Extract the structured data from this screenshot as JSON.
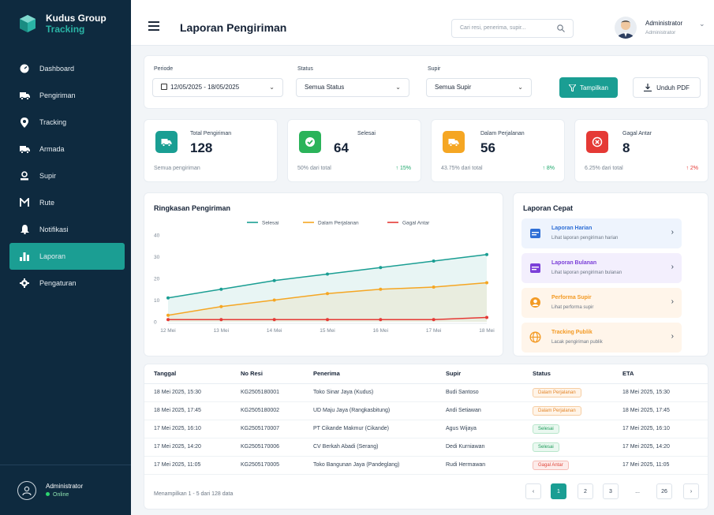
{
  "brand": {
    "name": "Kudus Group",
    "sub": "Tracking"
  },
  "sidebar": {
    "items": [
      {
        "label": "Dashboard",
        "icon": "dashboard-icon"
      },
      {
        "label": "Pengiriman",
        "icon": "truck-icon"
      },
      {
        "label": "Tracking",
        "icon": "location-pin-icon"
      },
      {
        "label": "Armada",
        "icon": "truck-icon"
      },
      {
        "label": "Supir",
        "icon": "person-icon"
      },
      {
        "label": "Rute",
        "icon": "route-icon"
      },
      {
        "label": "Notifikasi",
        "icon": "bell-icon"
      },
      {
        "label": "Laporan",
        "icon": "bar-chart-icon",
        "active": true
      },
      {
        "label": "Pengaturan",
        "icon": "gear-icon"
      }
    ],
    "footer": {
      "name": "Administrator",
      "status": "Online"
    }
  },
  "header": {
    "title": "Laporan Pengiriman",
    "search_placeholder": "Cari resi, penerima, supir...",
    "user_name": "Administrator",
    "user_role": "Administrator"
  },
  "filters": {
    "periode_label": "Periode",
    "periode_value": "12/05/2025 - 18/05/2025",
    "status_label": "Status",
    "status_value": "Semua Status",
    "supir_label": "Supir",
    "supir_value": "Semua Supir",
    "show_button": "Tampilkan",
    "pdf_button": "Unduh PDF"
  },
  "stats": [
    {
      "title": "Total Pengiriman",
      "value": "128",
      "sub": "Semua pengiriman",
      "change": "",
      "color": "#1a9e93"
    },
    {
      "title": "Selesai",
      "value": "64",
      "sub": "50% dari total",
      "change": "↑ 15%",
      "dir": "up",
      "color": "#2bb35a"
    },
    {
      "title": "Dalam Perjalanan",
      "value": "56",
      "sub": "43.75% dari total",
      "change": "↑ 8%",
      "dir": "up",
      "color": "#f5a623"
    },
    {
      "title": "Gagal Antar",
      "value": "8",
      "sub": "6.25% dari total",
      "change": "↑ 2%",
      "dir": "down",
      "color": "#e53935"
    }
  ],
  "chart": {
    "title": "Ringkasan Pengiriman"
  },
  "chart_data": {
    "type": "line",
    "title": "Ringkasan Pengiriman",
    "x": [
      "12 Mei",
      "13 Mei",
      "14 Mei",
      "15 Mei",
      "16 Mei",
      "17 Mei",
      "18 Mei"
    ],
    "ylim": [
      0,
      40
    ],
    "yticks": [
      0,
      10,
      20,
      30,
      40
    ],
    "grid": false,
    "legend": "top",
    "series": [
      {
        "name": "Selesai",
        "color": "#1a9e93",
        "values": [
          11,
          15,
          19,
          22,
          25,
          28,
          31
        ]
      },
      {
        "name": "Dalam Perjalanan",
        "color": "#f5a623",
        "values": [
          3,
          7,
          10,
          13,
          15,
          16,
          18
        ]
      },
      {
        "name": "Gagal Antar",
        "color": "#e53935",
        "values": [
          1,
          1,
          1,
          1,
          1,
          1,
          2
        ]
      }
    ]
  },
  "quick": {
    "title": "Laporan Cepat",
    "items": [
      {
        "title": "Laporan Harian",
        "desc": "Lihat laporan pengiriman harian",
        "bg": "#eef4fd",
        "color": "#2f6fd6",
        "icon": "calendar-icon"
      },
      {
        "title": "Laporan Bulanan",
        "desc": "Lihat laporan pengiriman bulanan",
        "bg": "#f3effd",
        "color": "#7b3fd8",
        "icon": "calendar-icon"
      },
      {
        "title": "Performa Supir",
        "desc": "Lihat performa supir",
        "bg": "#fff5ea",
        "color": "#f39a24",
        "icon": "person-icon"
      },
      {
        "title": "Tracking Publik",
        "desc": "Lacak pengiriman publik",
        "bg": "#fff5ea",
        "color": "#f39a24",
        "icon": "globe-icon"
      }
    ]
  },
  "table": {
    "headers": [
      "Tanggal",
      "No Resi",
      "Penerima",
      "Supir",
      "Status",
      "ETA"
    ],
    "rows": [
      {
        "date": "18 Mei 2025, 15:30",
        "resi": "KG2505180001",
        "recv": "Toko Sinar Jaya (Kudus)",
        "driver": "Budi Santoso",
        "status": "Dalam Perjalanan",
        "st": "warn",
        "eta": "18 Mei 2025, 15:30"
      },
      {
        "date": "18 Mei 2025, 17:45",
        "resi": "KG2505180002",
        "recv": "UD Maju Jaya (Rangkasbitung)",
        "driver": "Andi Setiawan",
        "status": "Dalam Perjalanan",
        "st": "warn",
        "eta": "18 Mei 2025, 17:45"
      },
      {
        "date": "17 Mei 2025, 16:10",
        "resi": "KG2505170007",
        "recv": "PT Cikande Makmur (Cikande)",
        "driver": "Agus Wijaya",
        "status": "Selesai",
        "st": "ok",
        "eta": "17 Mei 2025, 16:10"
      },
      {
        "date": "17 Mei 2025, 14:20",
        "resi": "KG2505170006",
        "recv": "CV Berkah Abadi (Serang)",
        "driver": "Dedi Kurniawan",
        "status": "Selesai",
        "st": "ok",
        "eta": "17 Mei 2025, 14:20"
      },
      {
        "date": "17 Mei 2025, 11:05",
        "resi": "KG2505170005",
        "recv": "Toko Bangunan Jaya (Pandeglang)",
        "driver": "Rudi Hermawan",
        "status": "Gagal Antar",
        "st": "bad",
        "eta": "17 Mei 2025, 11:05"
      }
    ],
    "footer": "Menampilkan 1 - 5 dari 128 data"
  },
  "pagination": {
    "prev": "‹",
    "p1": "1",
    "p2": "2",
    "p3": "3",
    "dots": "...",
    "last": "26",
    "next": "›"
  }
}
